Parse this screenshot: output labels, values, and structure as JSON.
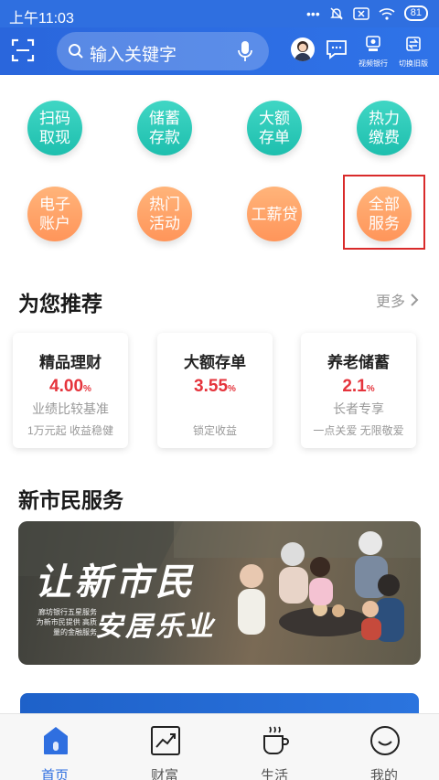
{
  "status_bar": {
    "time": "上午11:03",
    "battery": "81"
  },
  "header": {
    "search_placeholder": "输入关键字",
    "video_bank_label": "视频银行",
    "switch_version_label": "切换旧版"
  },
  "quick_actions": [
    {
      "label": "扫码取现",
      "color": "teal"
    },
    {
      "label": "储蓄存款",
      "color": "teal"
    },
    {
      "label": "大额存单",
      "color": "teal"
    },
    {
      "label": "热力缴费",
      "color": "teal"
    },
    {
      "label": "电子账户",
      "color": "orange"
    },
    {
      "label": "热门活动",
      "color": "orange"
    },
    {
      "label": "工薪贷",
      "color": "orange"
    },
    {
      "label": "全部服务",
      "color": "orange"
    }
  ],
  "recommend": {
    "title": "为您推荐",
    "more_label": "更多",
    "cards": [
      {
        "title": "精品理财",
        "rate": "4.00",
        "unit": "%",
        "desc": "业绩比较基准",
        "tags": "1万元起   收益稳健"
      },
      {
        "title": "大额存单",
        "rate": "3.55",
        "unit": "%",
        "desc": "",
        "tags": "锁定收益"
      },
      {
        "title": "养老储蓄",
        "rate": "2.1",
        "unit": "%",
        "desc": "长者专享",
        "tags": "一点关爱   无限敬爱"
      }
    ]
  },
  "new_citizen": {
    "title": "新市民服务",
    "banner_line1": "让新市民",
    "banner_line2": "安居乐业",
    "banner_sub": "廊坊银行五星服务 为新市民提供 高质量的金融服务"
  },
  "tabbar": {
    "items": [
      {
        "label": "首页",
        "active": true
      },
      {
        "label": "财富",
        "active": false
      },
      {
        "label": "生活",
        "active": false
      },
      {
        "label": "我的",
        "active": false
      }
    ],
    "active_color": "#2f6fe0"
  }
}
